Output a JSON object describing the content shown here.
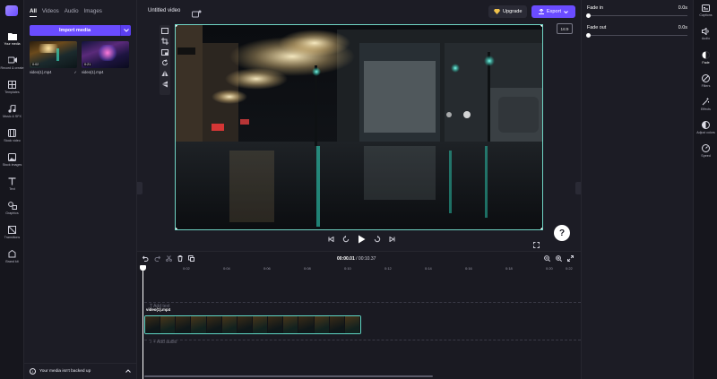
{
  "rail": {
    "items": [
      {
        "label": "Your media",
        "icon": "folder-icon",
        "active": true
      },
      {
        "label": "Record & create",
        "icon": "camera-icon"
      },
      {
        "label": "Templates",
        "icon": "templates-icon"
      },
      {
        "label": "Music & SFX",
        "icon": "music-icon"
      },
      {
        "label": "Stock video",
        "icon": "film-icon"
      },
      {
        "label": "Stock images",
        "icon": "image-icon"
      },
      {
        "label": "Text",
        "icon": "text-icon"
      },
      {
        "label": "Graphics",
        "icon": "shapes-icon"
      },
      {
        "label": "Transitions",
        "icon": "transition-icon"
      },
      {
        "label": "Brand kit",
        "icon": "brand-icon"
      }
    ]
  },
  "media": {
    "tabs": [
      "All",
      "Videos",
      "Audio",
      "Images"
    ],
    "active_tab": "All",
    "import_label": "Import media",
    "items": [
      {
        "name": "video(1).mp4",
        "badge": "0:02"
      },
      {
        "name": "video(1).mp4",
        "badge": "0:21"
      }
    ],
    "backup_text": "Your media isn't backed up"
  },
  "topbar": {
    "title": "Untitled video",
    "upgrade_label": "Upgrade",
    "export_label": "Export"
  },
  "preview": {
    "ratio": "16:9",
    "help": "?"
  },
  "timeline": {
    "current_time": "00:00.01",
    "total_time": "00:10.37",
    "separator": "/",
    "ruler": [
      "0",
      "0:02",
      "0:04",
      "0:06",
      "0:08",
      "0:10",
      "0:12",
      "0:14",
      "0:16",
      "0:18",
      "0:20",
      "0:22"
    ],
    "text_track": "T  Add text",
    "clip_label": "video(1).mp4",
    "audio_track": "♪  + Add audio"
  },
  "props": {
    "fade_in_label": "Fade in",
    "fade_in_value": "0.0s",
    "fade_out_label": "Fade out",
    "fade_out_value": "0.0s"
  },
  "rrail": {
    "items": [
      {
        "label": "Captions"
      },
      {
        "label": "Audio"
      },
      {
        "label": "Fade",
        "active": true
      },
      {
        "label": "Filters"
      },
      {
        "label": "Effects"
      },
      {
        "label": "Adjust colors"
      },
      {
        "label": "Speed"
      }
    ]
  },
  "colors": {
    "accent": "#6a4cff",
    "selection": "#6fd3c4",
    "background": "#1c1c25"
  }
}
